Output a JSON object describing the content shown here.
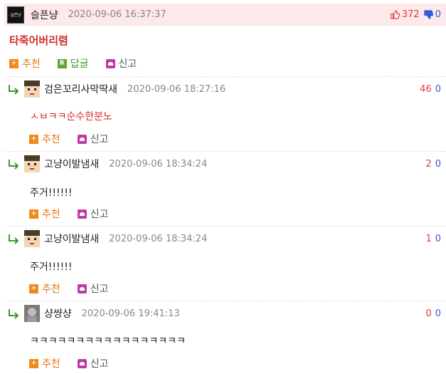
{
  "main": {
    "nickname": "슬픈냥",
    "date": "2020-09-06 16:37:37",
    "up_votes": "372",
    "down_votes": "0",
    "title": "타죽어버리렴",
    "avatar_text": "슬픈냥"
  },
  "actions": {
    "recommend": "추천",
    "reply": "답글",
    "report": "신고",
    "reply_badge": "R",
    "recommend_badge": "+"
  },
  "replies": [
    {
      "nickname": "검은꼬리사막딱새",
      "date": "2020-09-06 18:27:16",
      "up": "46",
      "down": "0",
      "body": "ㅅㅂㅋㅋ순수한분노"
    },
    {
      "nickname": "고냥이발냄새",
      "date": "2020-09-06 18:34:24",
      "up": "2",
      "down": "0",
      "body": "주거!!!!!!"
    },
    {
      "nickname": "고냥이발냄새",
      "date": "2020-09-06 18:34:24",
      "up": "1",
      "down": "0",
      "body": "주거!!!!!!"
    },
    {
      "nickname": "샹썅샹",
      "date": "2020-09-06 19:41:13",
      "up": "0",
      "down": "0",
      "body": "ㅋㅋㅋㅋㅋㅋㅋㅋㅋㅋㅋㅋㅋㅋㅋㅋㅋ"
    }
  ],
  "colors": {
    "header_bg": "#fde8ea",
    "accent_red": "#d42a2a",
    "vote_up": "#e23a3a",
    "vote_down": "#3a55d6"
  }
}
